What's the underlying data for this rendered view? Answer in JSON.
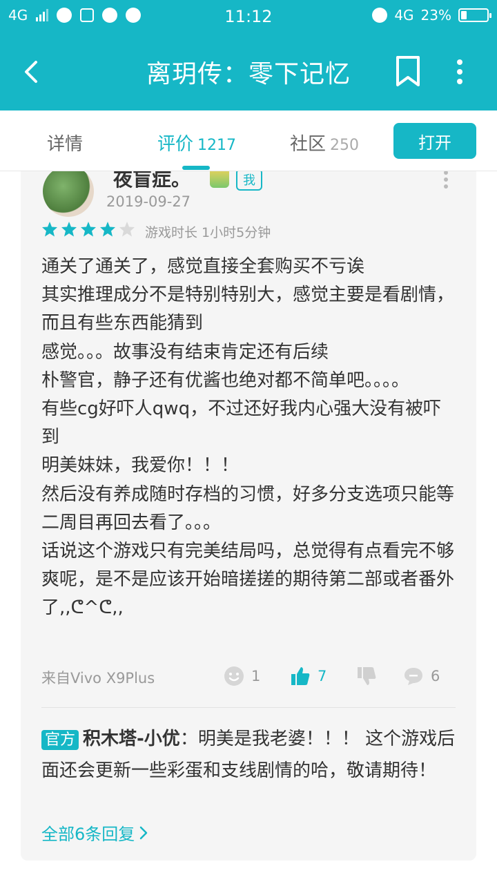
{
  "status_bar": {
    "network_left": "4G",
    "time": "11:12",
    "network_right": "4G",
    "battery_percent_text": "23%",
    "battery_level": 0.23
  },
  "app_bar": {
    "title": "离玥传：零下记忆"
  },
  "tabs": [
    {
      "label": "详情",
      "count": ""
    },
    {
      "label": "评价",
      "count": "1217"
    },
    {
      "label": "社区",
      "count": "250"
    }
  ],
  "open_button": "打开",
  "review": {
    "username": "夜盲症。",
    "me_tag": "我",
    "date": "2019-09-27",
    "rating": 4,
    "rating_max": 5,
    "playtime": "游戏时长 1小时5分钟",
    "lines": [
      "通关了通关了，感觉直接全套购买不亏诶",
      "其实推理成分不是特别特别大，感觉主要是看剧情，而且有些东西能猜到",
      "感觉。。。故事没有结束肯定还有后续",
      "朴警官，静子还有优酱也绝对都不简单吧。。。。",
      "有些cg好吓人qwq，不过还好我内心强大没有被吓到",
      "明美妹妹，我爱你！！！",
      "然后没有养成随时存档的习惯，好多分支选项只能等二周目再回去看了。。。",
      "话说这个游戏只有完美结局吗，总觉得有点看完不够爽呢，是不是应该开始暗搓搓的期待第二部或者番外了,,ᕦ^ᕦ,,"
    ],
    "device": "来自Vivo X9Plus",
    "actions": {
      "funny_count": "1",
      "like_count": "7",
      "dislike_count": "",
      "comment_count": "6"
    }
  },
  "reply": {
    "tag": "官方",
    "author": "积木塔-小优",
    "text": "：明美是我老婆！！！ 这个游戏后面还会更新一些彩蛋和支线剧情的哈，敬请期待！",
    "all_replies_link": "全部6条回复"
  },
  "colors": {
    "accent": "#16b7c6",
    "star_empty": "#d9d9d9"
  }
}
